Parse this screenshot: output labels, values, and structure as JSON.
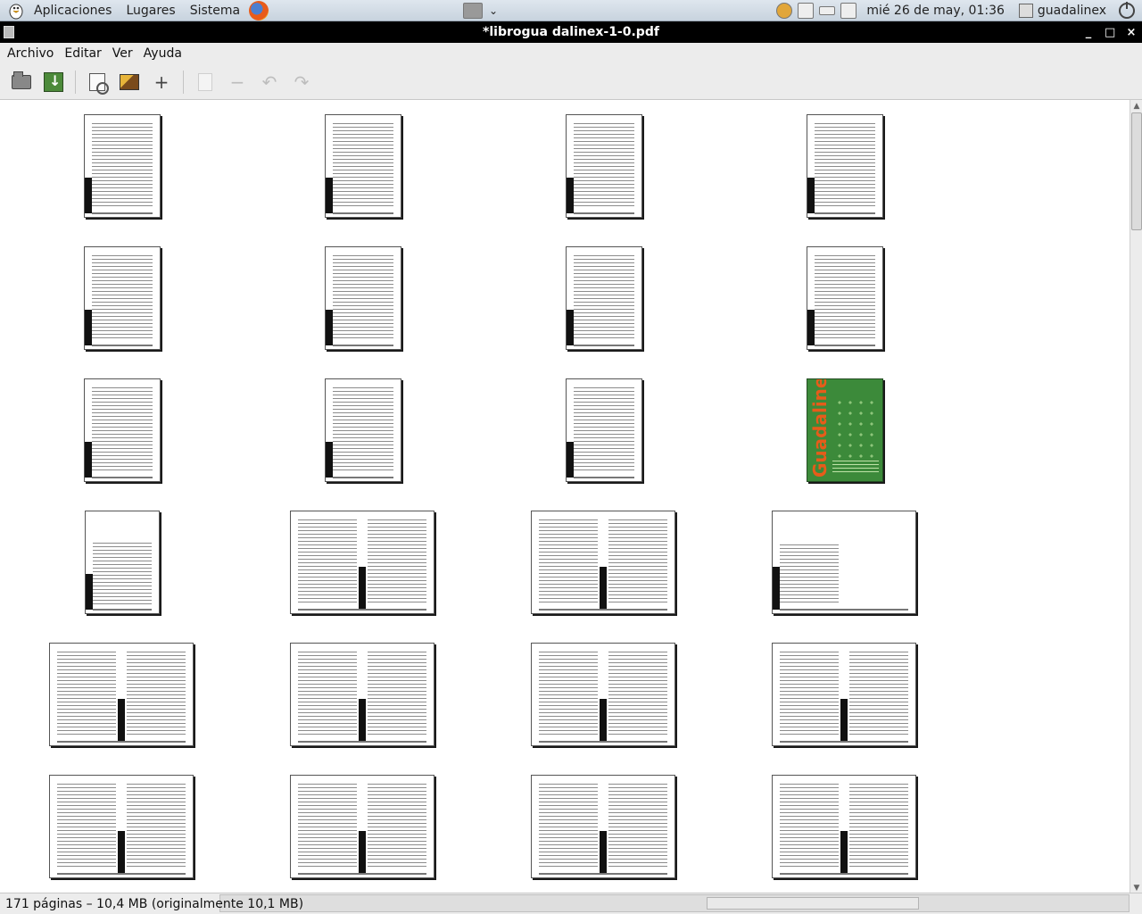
{
  "panel": {
    "menus": [
      "Aplicaciones",
      "Lugares",
      "Sistema"
    ],
    "clock": "mié 26 de may, 01:36",
    "user": "guadalinex"
  },
  "window": {
    "title": "*librogua dalinex-1-0.pdf",
    "controls": [
      "_",
      "□",
      "×"
    ]
  },
  "menubar": {
    "items": [
      {
        "label": "Archivo"
      },
      {
        "label": "Editar"
      },
      {
        "label": "Ver"
      },
      {
        "label": "Ayuda"
      }
    ]
  },
  "toolbar": {
    "icons": [
      "open-icon",
      "save-icon",
      "zoom-icon",
      "import-image-icon",
      "add-icon",
      "page-icon",
      "remove-icon",
      "rotate-left-icon",
      "rotate-right-icon"
    ],
    "add_glyph": "+",
    "remove_glyph": "−",
    "rotate_left_glyph": "↶",
    "rotate_right_glyph": "↷"
  },
  "document": {
    "cover_brand": "Guadalinex"
  },
  "status": {
    "text": "171 páginas – 10,4 MB (originalmente 10,1 MB)"
  }
}
